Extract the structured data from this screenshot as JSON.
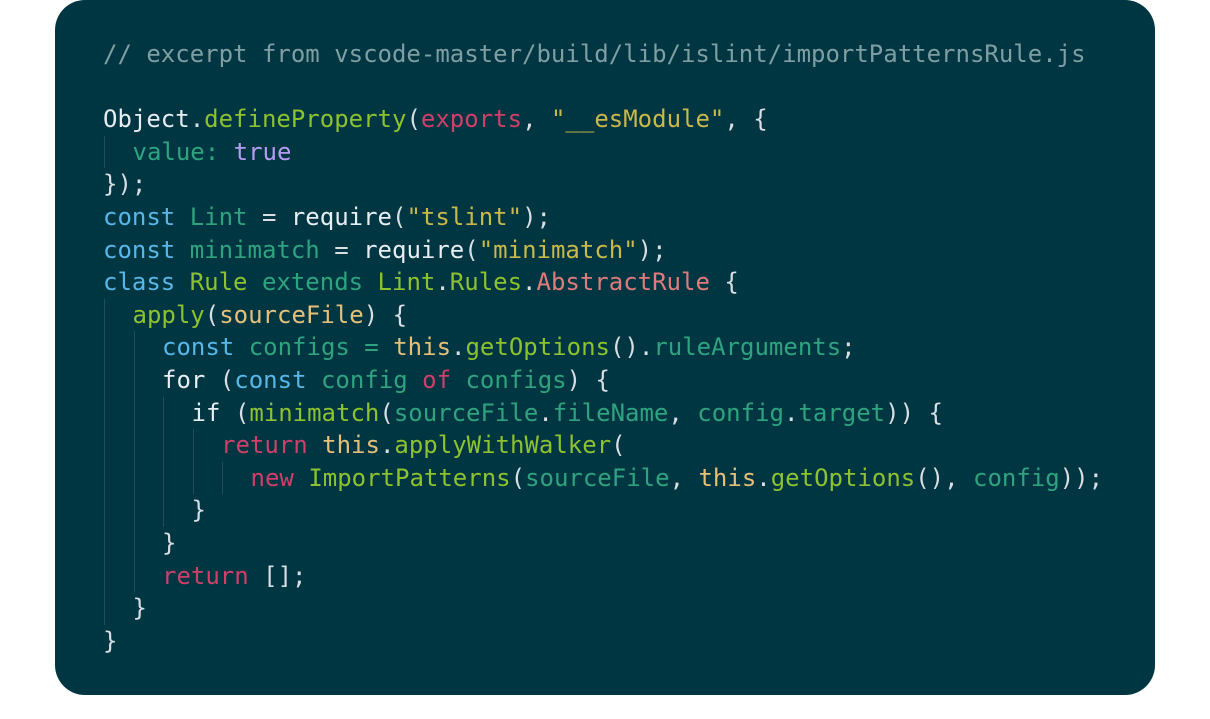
{
  "colors": {
    "background": "#003641",
    "comment": "#7f9ea4",
    "keyword": "#58b6e8",
    "control": "#cf3f6a",
    "function": "#8dc12f",
    "string": "#c9b84a",
    "variable": "#2fa37f",
    "property": "#2fa37f",
    "punctuation": "#d8dee3",
    "plain": "#e6edf3",
    "this": "#e5c07b",
    "boolean": "#b69cf0",
    "class": "#e07b7b"
  },
  "code": {
    "lines": [
      {
        "indent": 0,
        "tokens": [
          {
            "t": "// excerpt from vscode-master/build/lib/islint/importPatternsRule.js",
            "c": "comment"
          }
        ]
      },
      {
        "indent": 0,
        "tokens": []
      },
      {
        "indent": 0,
        "tokens": [
          {
            "t": "Object",
            "c": "plain"
          },
          {
            "t": ".",
            "c": "punctuation"
          },
          {
            "t": "defineProperty",
            "c": "function"
          },
          {
            "t": "(",
            "c": "punctuation"
          },
          {
            "t": "exports",
            "c": "control"
          },
          {
            "t": ", ",
            "c": "punctuation"
          },
          {
            "t": "\"__esModule\"",
            "c": "string"
          },
          {
            "t": ", {",
            "c": "punctuation"
          }
        ]
      },
      {
        "indent": 1,
        "tokens": [
          {
            "t": "value",
            "c": "variable"
          },
          {
            "t": ": ",
            "c": "variable"
          },
          {
            "t": "true",
            "c": "boolean"
          }
        ]
      },
      {
        "indent": 0,
        "tokens": [
          {
            "t": "});",
            "c": "punctuation"
          }
        ]
      },
      {
        "indent": 0,
        "tokens": [
          {
            "t": "const",
            "c": "keyword"
          },
          {
            "t": " ",
            "c": "plain"
          },
          {
            "t": "Lint",
            "c": "variable"
          },
          {
            "t": " = ",
            "c": "punctuation"
          },
          {
            "t": "require",
            "c": "plain"
          },
          {
            "t": "(",
            "c": "punctuation"
          },
          {
            "t": "\"tslint\"",
            "c": "string"
          },
          {
            "t": ");",
            "c": "punctuation"
          }
        ]
      },
      {
        "indent": 0,
        "tokens": [
          {
            "t": "const",
            "c": "keyword"
          },
          {
            "t": " ",
            "c": "plain"
          },
          {
            "t": "minimatch",
            "c": "variable"
          },
          {
            "t": " = ",
            "c": "punctuation"
          },
          {
            "t": "require",
            "c": "plain"
          },
          {
            "t": "(",
            "c": "punctuation"
          },
          {
            "t": "\"minimatch\"",
            "c": "string"
          },
          {
            "t": ");",
            "c": "punctuation"
          }
        ]
      },
      {
        "indent": 0,
        "tokens": [
          {
            "t": "class",
            "c": "keyword"
          },
          {
            "t": " ",
            "c": "plain"
          },
          {
            "t": "Rule",
            "c": "function"
          },
          {
            "t": " extends ",
            "c": "variable"
          },
          {
            "t": "Lint",
            "c": "function"
          },
          {
            "t": ".",
            "c": "punctuation"
          },
          {
            "t": "Rules",
            "c": "function"
          },
          {
            "t": ".",
            "c": "punctuation"
          },
          {
            "t": "AbstractRule",
            "c": "class"
          },
          {
            "t": " {",
            "c": "punctuation"
          }
        ]
      },
      {
        "indent": 1,
        "tokens": [
          {
            "t": "apply",
            "c": "function"
          },
          {
            "t": "(",
            "c": "punctuation"
          },
          {
            "t": "sourceFile",
            "c": "this"
          },
          {
            "t": ") {",
            "c": "punctuation"
          }
        ]
      },
      {
        "indent": 2,
        "tokens": [
          {
            "t": "const",
            "c": "keyword"
          },
          {
            "t": " ",
            "c": "plain"
          },
          {
            "t": "configs",
            "c": "variable"
          },
          {
            "t": " = ",
            "c": "variable"
          },
          {
            "t": "this",
            "c": "this"
          },
          {
            "t": ".",
            "c": "punctuation"
          },
          {
            "t": "getOptions",
            "c": "function"
          },
          {
            "t": "().",
            "c": "punctuation"
          },
          {
            "t": "ruleArguments",
            "c": "property"
          },
          {
            "t": ";",
            "c": "punctuation"
          }
        ]
      },
      {
        "indent": 2,
        "tokens": [
          {
            "t": "for",
            "c": "plain"
          },
          {
            "t": " (",
            "c": "punctuation"
          },
          {
            "t": "const",
            "c": "keyword"
          },
          {
            "t": " ",
            "c": "plain"
          },
          {
            "t": "config",
            "c": "variable"
          },
          {
            "t": " ",
            "c": "plain"
          },
          {
            "t": "of",
            "c": "control"
          },
          {
            "t": " ",
            "c": "plain"
          },
          {
            "t": "configs",
            "c": "variable"
          },
          {
            "t": ") {",
            "c": "punctuation"
          }
        ]
      },
      {
        "indent": 3,
        "tokens": [
          {
            "t": "if",
            "c": "plain"
          },
          {
            "t": " (",
            "c": "punctuation"
          },
          {
            "t": "minimatch",
            "c": "function"
          },
          {
            "t": "(",
            "c": "punctuation"
          },
          {
            "t": "sourceFile",
            "c": "variable"
          },
          {
            "t": ".",
            "c": "punctuation"
          },
          {
            "t": "fileName",
            "c": "property"
          },
          {
            "t": ", ",
            "c": "punctuation"
          },
          {
            "t": "config",
            "c": "variable"
          },
          {
            "t": ".",
            "c": "punctuation"
          },
          {
            "t": "target",
            "c": "property"
          },
          {
            "t": ")) {",
            "c": "punctuation"
          }
        ]
      },
      {
        "indent": 4,
        "tokens": [
          {
            "t": "return",
            "c": "control"
          },
          {
            "t": " ",
            "c": "plain"
          },
          {
            "t": "this",
            "c": "this"
          },
          {
            "t": ".",
            "c": "punctuation"
          },
          {
            "t": "applyWithWalker",
            "c": "function"
          },
          {
            "t": "(",
            "c": "punctuation"
          }
        ]
      },
      {
        "indent": 5,
        "tokens": [
          {
            "t": "new",
            "c": "control"
          },
          {
            "t": " ",
            "c": "plain"
          },
          {
            "t": "ImportPatterns",
            "c": "function"
          },
          {
            "t": "(",
            "c": "punctuation"
          },
          {
            "t": "sourceFile",
            "c": "variable"
          },
          {
            "t": ", ",
            "c": "punctuation"
          },
          {
            "t": "this",
            "c": "this"
          },
          {
            "t": ".",
            "c": "punctuation"
          },
          {
            "t": "getOptions",
            "c": "function"
          },
          {
            "t": "(), ",
            "c": "punctuation"
          },
          {
            "t": "config",
            "c": "variable"
          },
          {
            "t": "));",
            "c": "punctuation"
          }
        ]
      },
      {
        "indent": 3,
        "tokens": [
          {
            "t": "}",
            "c": "punctuation"
          }
        ]
      },
      {
        "indent": 2,
        "tokens": [
          {
            "t": "}",
            "c": "punctuation"
          }
        ]
      },
      {
        "indent": 2,
        "tokens": [
          {
            "t": "return",
            "c": "control"
          },
          {
            "t": " ",
            "c": "plain"
          },
          {
            "t": "[];",
            "c": "punctuation"
          }
        ]
      },
      {
        "indent": 1,
        "tokens": [
          {
            "t": "}",
            "c": "punctuation"
          }
        ]
      },
      {
        "indent": 0,
        "tokens": [
          {
            "t": "}",
            "c": "punctuation"
          }
        ]
      }
    ]
  }
}
